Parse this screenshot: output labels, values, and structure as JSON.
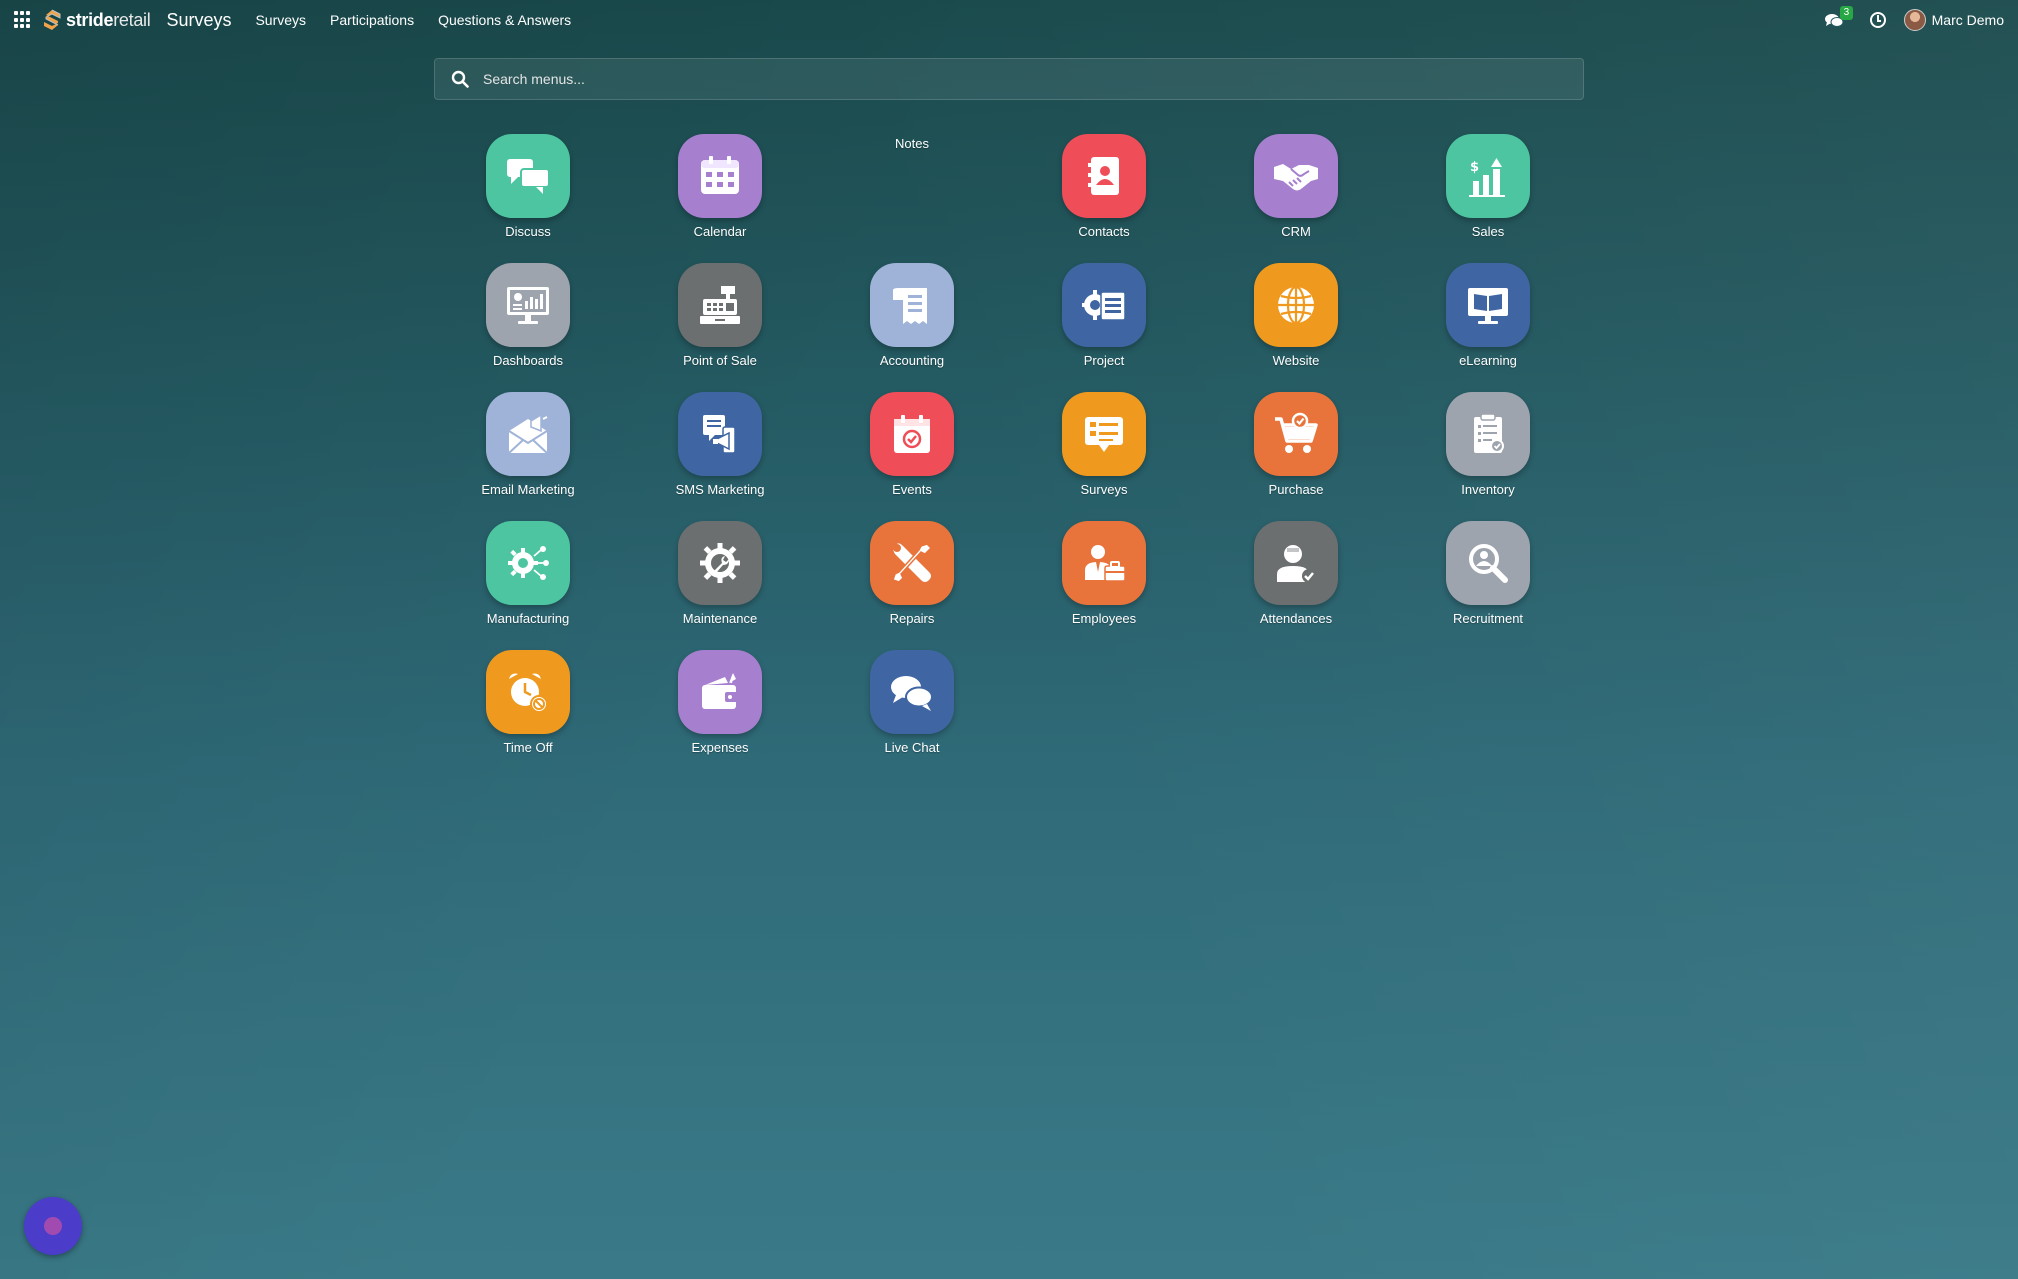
{
  "navbar": {
    "brand_bold": "stride",
    "brand_light": "retail",
    "app_title": "Surveys",
    "menu": [
      "Surveys",
      "Participations",
      "Questions & Answers"
    ],
    "chat_badge": "3",
    "user_name": "Marc Demo"
  },
  "search": {
    "placeholder": "Search menus..."
  },
  "apps": [
    {
      "label": "Discuss",
      "color": "#4cc5a0",
      "icon": "discuss-icon"
    },
    {
      "label": "Calendar",
      "color": "#a67fcf",
      "icon": "calendar-icon"
    },
    {
      "label": "Notes",
      "color": "",
      "icon": ""
    },
    {
      "label": "Contacts",
      "color": "#ef4d57",
      "icon": "contacts-icon"
    },
    {
      "label": "CRM",
      "color": "#a67fcf",
      "icon": "handshake-icon"
    },
    {
      "label": "Sales",
      "color": "#4cc5a0",
      "icon": "sales-chart-icon"
    },
    {
      "label": "Dashboards",
      "color": "#9ea4ae",
      "icon": "dashboard-icon"
    },
    {
      "label": "Point of Sale",
      "color": "#6b6f70",
      "icon": "cash-register-icon"
    },
    {
      "label": "Accounting",
      "color": "#9fb3d8",
      "icon": "receipt-icon"
    },
    {
      "label": "Project",
      "color": "#3f66a3",
      "icon": "project-icon"
    },
    {
      "label": "Website",
      "color": "#ef9a1f",
      "icon": "globe-icon"
    },
    {
      "label": "eLearning",
      "color": "#3f66a3",
      "icon": "elearning-icon"
    },
    {
      "label": "Email Marketing",
      "color": "#9fb3d8",
      "icon": "email-marketing-icon"
    },
    {
      "label": "SMS Marketing",
      "color": "#3f66a3",
      "icon": "sms-marketing-icon"
    },
    {
      "label": "Events",
      "color": "#ef4d57",
      "icon": "event-icon"
    },
    {
      "label": "Surveys",
      "color": "#ef9a1f",
      "icon": "survey-icon"
    },
    {
      "label": "Purchase",
      "color": "#e8743b",
      "icon": "cart-icon"
    },
    {
      "label": "Inventory",
      "color": "#9ea4ae",
      "icon": "clipboard-icon"
    },
    {
      "label": "Manufacturing",
      "color": "#4cc5a0",
      "icon": "gear-network-icon"
    },
    {
      "label": "Maintenance",
      "color": "#6b6f70",
      "icon": "wrench-gear-icon"
    },
    {
      "label": "Repairs",
      "color": "#e8743b",
      "icon": "tools-icon"
    },
    {
      "label": "Employees",
      "color": "#e8743b",
      "icon": "employee-icon"
    },
    {
      "label": "Attendances",
      "color": "#6b6f70",
      "icon": "attendance-icon"
    },
    {
      "label": "Recruitment",
      "color": "#9ea4ae",
      "icon": "recruit-search-icon"
    },
    {
      "label": "Time Off",
      "color": "#ef9a1f",
      "icon": "alarm-clock-icon"
    },
    {
      "label": "Expenses",
      "color": "#a67fcf",
      "icon": "wallet-icon"
    },
    {
      "label": "Live Chat",
      "color": "#3f66a3",
      "icon": "live-chat-icon"
    }
  ]
}
